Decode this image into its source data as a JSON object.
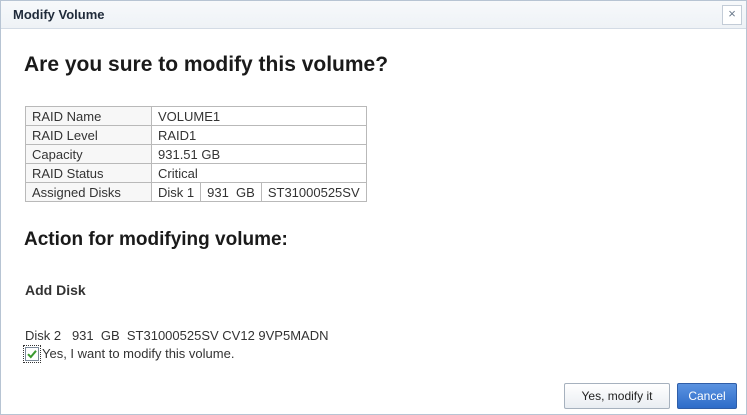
{
  "dialog": {
    "title": "Modify Volume",
    "close_glyph": "×",
    "question": "Are you sure to modify this volume?"
  },
  "raid": {
    "rows": [
      {
        "label": "RAID Name",
        "value": "VOLUME1"
      },
      {
        "label": "RAID Level",
        "value": "RAID1"
      },
      {
        "label": "Capacity",
        "value": "931.51 GB"
      },
      {
        "label": "RAID Status",
        "value": "Critical"
      }
    ],
    "assigned": {
      "label": "Assigned Disks",
      "disk": "Disk 1",
      "size": "931  GB",
      "model": "ST31000525SV"
    }
  },
  "action": {
    "heading": "Action for modifying volume:",
    "subheading": "Add Disk",
    "disk_line": "Disk 2   931  GB  ST31000525SV CV12 9VP5MADN",
    "confirm_label": "Yes, I want to modify this volume.",
    "confirm_checked": true
  },
  "buttons": {
    "confirm_label": "Yes, modify it",
    "cancel_label": "Cancel"
  },
  "colors": {
    "cancel_button": "#2e6cc9",
    "checkmark": "#3a9a2f"
  }
}
